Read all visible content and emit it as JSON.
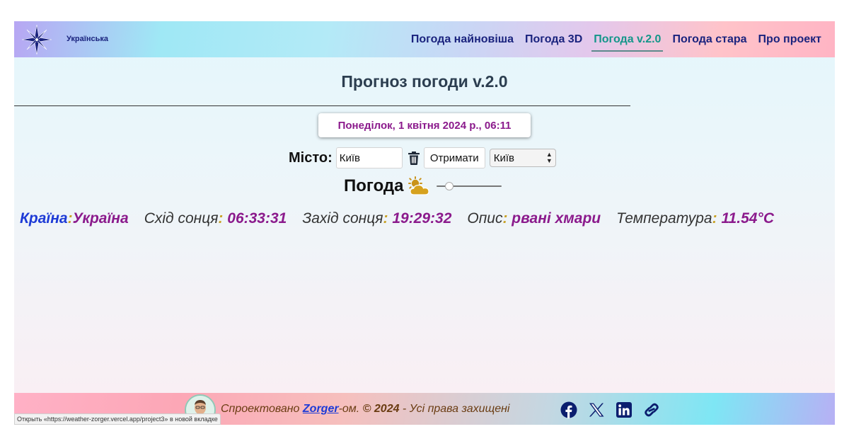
{
  "header": {
    "language": "Українська",
    "nav": [
      {
        "label": "Погода найновіша",
        "active": false
      },
      {
        "label": "Погода 3D",
        "active": false
      },
      {
        "label": "Погода v.2.0",
        "active": true
      },
      {
        "label": "Погода стара",
        "active": false
      },
      {
        "label": "Про проект",
        "active": false
      }
    ]
  },
  "main": {
    "title": "Прогноз погоди v.2.0",
    "date": "Понеділок, 1 квітня 2024 р., 06:11",
    "city_label": "Місто:",
    "city_input_value": "Київ",
    "get_button": "Отримати",
    "city_select_value": "Київ",
    "weather_label": "Погода",
    "weather_icon": "sun-behind-cloud-icon",
    "info": {
      "country_key": "Країна",
      "country_value": "Україна",
      "sunrise_key": "Схід сонця",
      "sunrise_value": "06:33:31",
      "sunset_key": "Захід сонця",
      "sunset_value": "19:29:32",
      "description_key": "Опис",
      "description_value": "рвані хмари",
      "temperature_key": "Температура",
      "temperature_value": "11.54°C",
      "colon": ":"
    }
  },
  "footer": {
    "prefix": "Спроектовано ",
    "author": "Zorger",
    "suffix_start": "-ом. ",
    "copyright_year": "© 2024",
    "rights": " - Усі права захищені",
    "social_icons": [
      "facebook-icon",
      "x-icon",
      "linkedin-icon",
      "link-icon"
    ]
  },
  "status_tip": "Открыть «https://weather-zorger.vercel.app/project3» в новой вкладке",
  "colors": {
    "nav_text": "#1a237e",
    "nav_active": "#14968a",
    "value_purple": "#8b1a8c",
    "key_blue": "#1e3bd6",
    "colon_gold": "#c9a227"
  }
}
